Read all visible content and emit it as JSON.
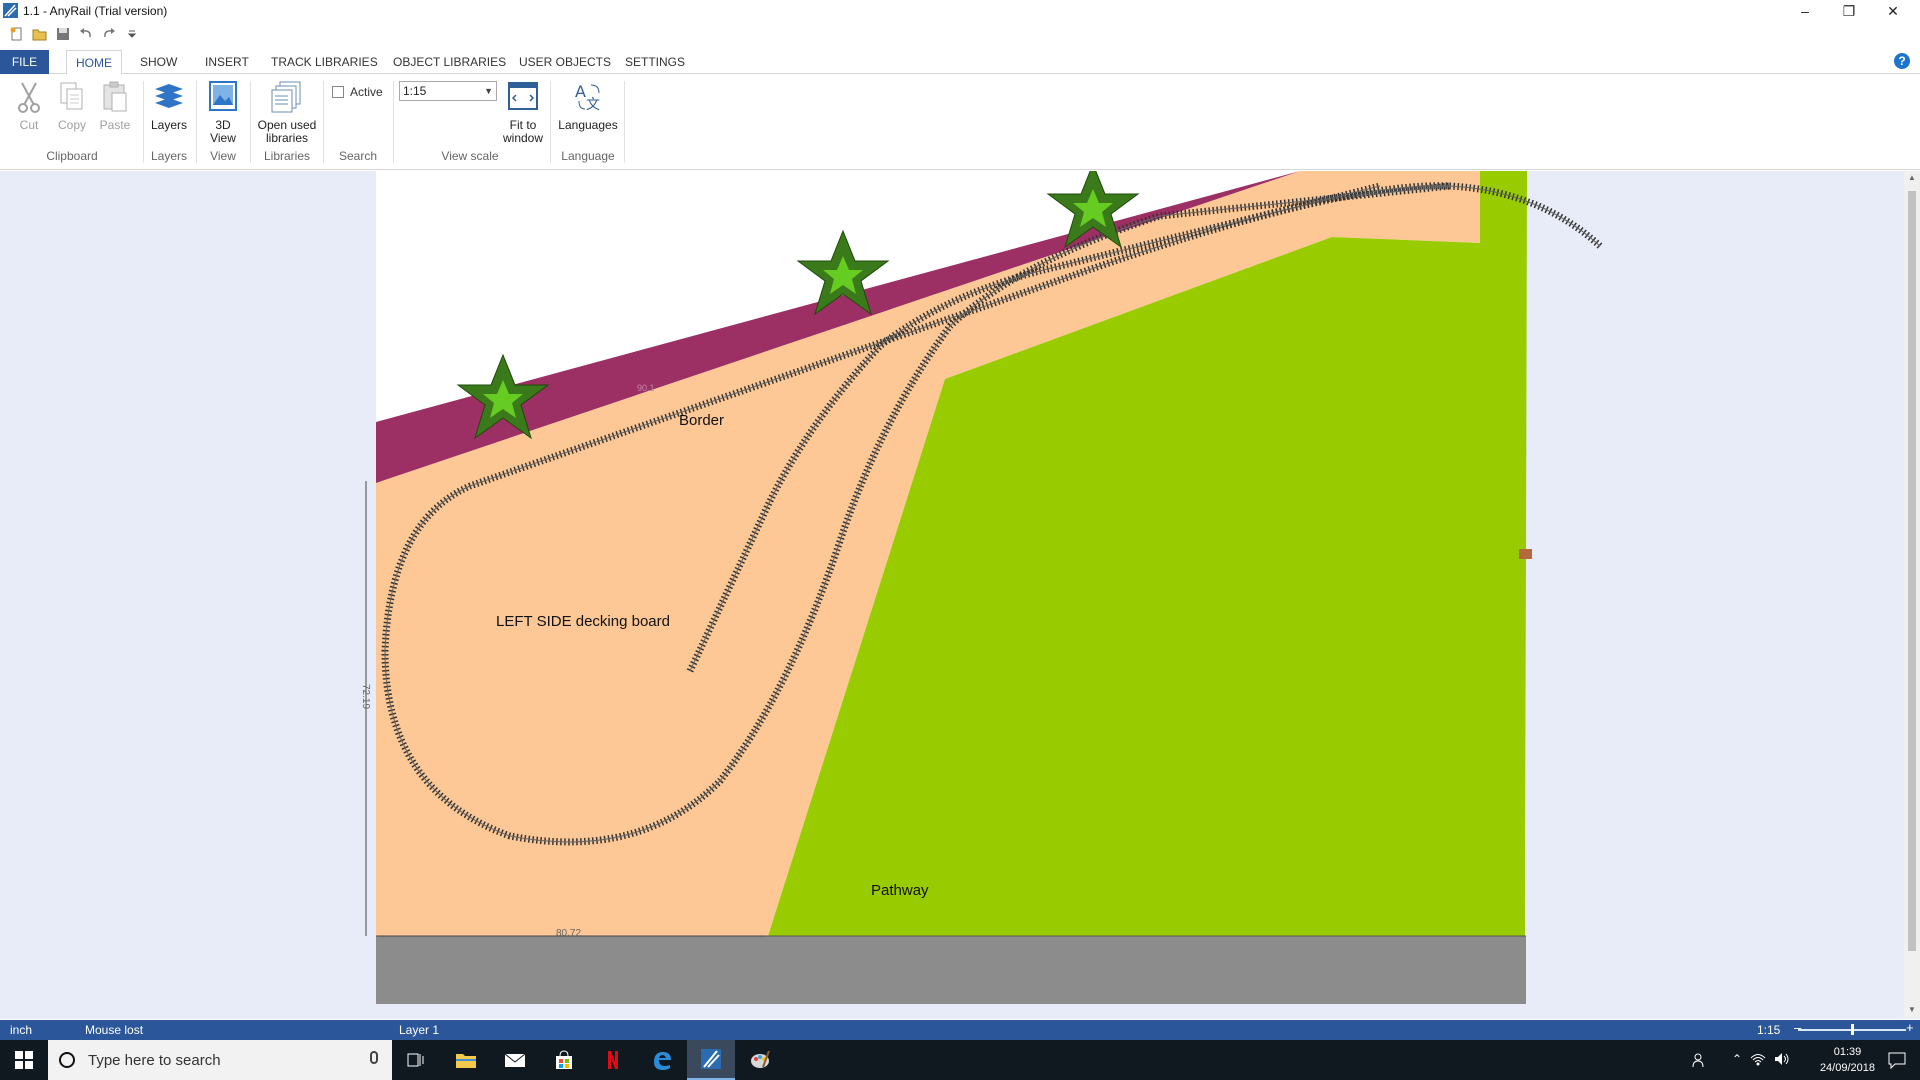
{
  "window": {
    "title": "1.1 - AnyRail (Trial version)",
    "controls": [
      "minimize",
      "restore",
      "close"
    ]
  },
  "quick_access": [
    "new",
    "open",
    "save",
    "undo",
    "redo",
    "customize"
  ],
  "ribbon": {
    "tabs": [
      "FILE",
      "HOME",
      "SHOW",
      "INSERT",
      "TRACK LIBRARIES",
      "OBJECT LIBRARIES",
      "USER OBJECTS",
      "SETTINGS"
    ],
    "active_tab": "HOME",
    "buttons": {
      "cut": "Cut",
      "copy": "Copy",
      "paste": "Paste",
      "layers": "Layers",
      "view3d_line1": "3D",
      "view3d_line2": "View",
      "open_libs_line1": "Open used",
      "open_libs_line2": "libraries",
      "fit_line1": "Fit to",
      "fit_line2": "window",
      "languages": "Languages"
    },
    "active_label": "Active",
    "active_checked": false,
    "view_scale_value": "1:15",
    "groups": [
      "Clipboard",
      "Layers",
      "View",
      "Libraries",
      "Search",
      "View scale",
      "Language"
    ]
  },
  "canvas": {
    "labels": {
      "border": "Border",
      "left_side": "LEFT SIDE decking board",
      "pathway": "Pathway",
      "dim_vertical": "72.19",
      "dim_horizontal": "80.72",
      "dim_small": "90.1"
    },
    "colors": {
      "background": "#e8ecf8",
      "decking": "#fdc896",
      "border": "#9c2f63",
      "grass": "#99cc00",
      "pathway": "#8c8c8c",
      "tree_dark": "#3b7a1a",
      "tree_light": "#66cc22",
      "track": "#333333"
    }
  },
  "statusbar": {
    "unit": "inch",
    "mouse": "Mouse lost",
    "layer": "Layer 1",
    "scale": "1:15"
  },
  "taskbar": {
    "search_placeholder": "Type here to search",
    "time": "01:39",
    "date": "24/09/2018"
  }
}
